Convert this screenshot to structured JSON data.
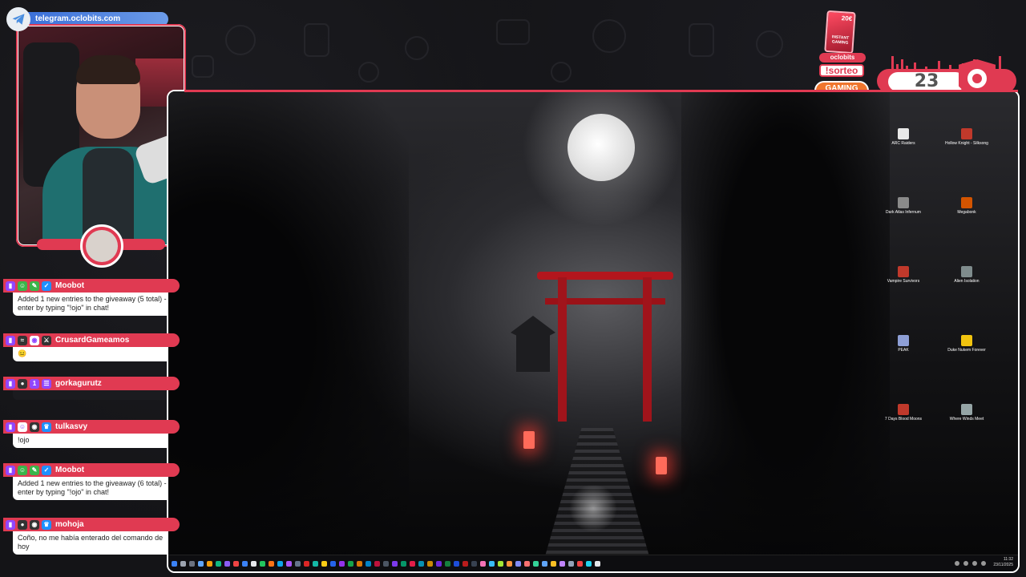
{
  "telegram": {
    "label": "telegram.oclobits.com"
  },
  "widgets": {
    "prize_amount": "20€",
    "prize_brand": "INSTANT GAMING",
    "brand_pill": "oclobits",
    "sorteo": "!sorteo",
    "gaming_title": "GAMING",
    "gaming_sub": "PLAY MORE PAY LESS",
    "counter": "23"
  },
  "chat": {
    "messages": [
      {
        "user": "Moobot",
        "text": "Added 1 new entries to the giveaway (5 total) - enter by typing \"!ojo\" in chat!"
      },
      {
        "user": "CrusardGameamos",
        "text": "😐"
      },
      {
        "user": "gorkagurutz",
        "text": ""
      },
      {
        "user": "tulkasvy",
        "text": "!ojo"
      },
      {
        "user": "Moobot",
        "text": "Added 1 new entries to the giveaway (6 total) - enter by typing \"!ojo\" in chat!"
      },
      {
        "user": "mohoja",
        "text": "Coño, no me había enterado del comando de hoy"
      }
    ]
  },
  "desktop": {
    "icons": [
      {
        "label": "ARC Raiders",
        "color": "#e8e8e8"
      },
      {
        "label": "Hollow Knight - Silksong",
        "color": "#c0392b"
      },
      {
        "label": "Dark Atlas Infernum",
        "color": "#8a8a8a"
      },
      {
        "label": "Megabonk",
        "color": "#d35400"
      },
      {
        "label": "Vampire Survivors",
        "color": "#c0392b"
      },
      {
        "label": "Alien Isolation",
        "color": "#7f8c8d"
      },
      {
        "label": "PEAK",
        "color": "#8e9fd6"
      },
      {
        "label": "Duke Nukem Forever",
        "color": "#f1c40f"
      },
      {
        "label": "7 Days Blood Moons",
        "color": "#c0392b"
      },
      {
        "label": "Where Winds Meet",
        "color": "#95a5a6"
      }
    ],
    "clock_time": "11:32",
    "clock_date": "23/11/2025"
  }
}
